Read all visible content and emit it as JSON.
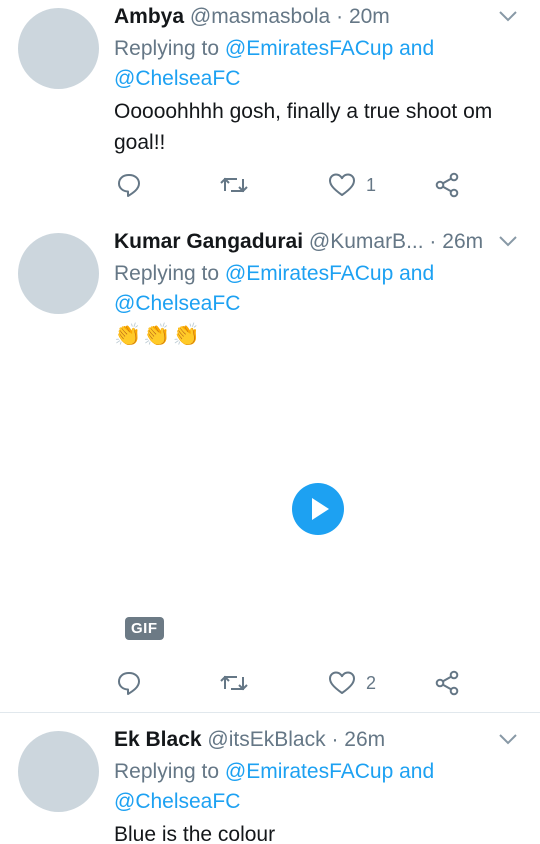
{
  "tweets": [
    {
      "name": "Ambya",
      "handle": "@masmasbola",
      "dot": "·",
      "time": "20m",
      "replying_prefix": "Replying to",
      "replying_to_1": "@EmiratesFACup",
      "replying_and": "and",
      "replying_to_2": "@ChelseaFC",
      "text": "Ooooohhhh gosh, finally a true shoot om goal!!",
      "like_count": "1"
    },
    {
      "name": "Kumar Gangadurai",
      "handle": "@KumarB...",
      "dot": "·",
      "time": "26m",
      "replying_prefix": "Replying to",
      "replying_to_1": "@EmiratesFACup",
      "replying_and": "and",
      "replying_to_2": "@ChelseaFC",
      "text": "👏👏👏",
      "media_badge": "GIF",
      "like_count": "2"
    },
    {
      "name": "Ek Black",
      "handle": "@itsEkBlack",
      "dot": "·",
      "time": "26m",
      "replying_prefix": "Replying to",
      "replying_to_1": "@EmiratesFACup",
      "replying_and": "and",
      "replying_to_2": "@ChelseaFC",
      "text": "Blue is the colour"
    }
  ],
  "colors": {
    "link": "#1da1f2",
    "secondary_text": "#657786",
    "avatar_placeholder": "#ccd6dd",
    "play_button": "#1da1f2"
  },
  "icons": [
    "chevron-down-icon",
    "reply-icon",
    "retweet-icon",
    "like-icon",
    "share-icon",
    "play-icon"
  ]
}
